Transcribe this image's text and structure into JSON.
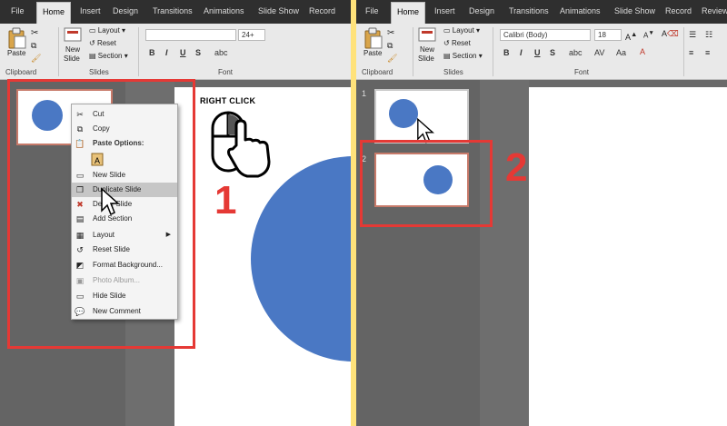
{
  "ribbon_tabs": [
    "File",
    "Home",
    "Insert",
    "Design",
    "Transitions",
    "Animations",
    "Slide Show",
    "Record"
  ],
  "ribbon_tabs_right": [
    "File",
    "Home",
    "Insert",
    "Design",
    "Transitions",
    "Animations",
    "Slide Show",
    "Record",
    "Review"
  ],
  "ribbon": {
    "paste": "Paste",
    "new_slide": "New\nSlide",
    "new_slide_line1": "New",
    "new_slide_line2": "Slide",
    "layout": "Layout",
    "reset": "Reset",
    "section": "Section",
    "clipboard": "Clipboard",
    "slides": "Slides",
    "font": "Font",
    "font_size_left": "24+",
    "font_name_right": "Calibri (Body)",
    "font_size_right": "18"
  },
  "left_panel": {
    "instruction": "RIGHT CLICK",
    "step_number": "1",
    "context_menu": [
      {
        "label": "Cut",
        "icon": "scissors-icon",
        "state": "normal"
      },
      {
        "label": "Copy",
        "icon": "copy-icon",
        "state": "normal"
      },
      {
        "label": "Paste Options:",
        "icon": "paste-options-icon",
        "state": "header"
      },
      {
        "label": "",
        "icon": "paste-keep-text-icon",
        "state": "icon-only"
      },
      {
        "label": "New Slide",
        "icon": "new-slide-icon",
        "state": "normal"
      },
      {
        "label": "Duplicate Slide",
        "icon": "duplicate-slide-icon",
        "state": "highlighted"
      },
      {
        "label": "Delete Slide",
        "icon": "delete-slide-icon",
        "state": "normal"
      },
      {
        "label": "Add Section",
        "icon": "add-section-icon",
        "state": "normal"
      },
      {
        "label": "Layout",
        "icon": "layout-icon",
        "state": "submenu"
      },
      {
        "label": "Reset Slide",
        "icon": "reset-slide-icon",
        "state": "normal"
      },
      {
        "label": "Format Background...",
        "icon": "format-background-icon",
        "state": "normal"
      },
      {
        "label": "Photo Album...",
        "icon": "photo-album-icon",
        "state": "disabled"
      },
      {
        "label": "Hide Slide",
        "icon": "hide-slide-icon",
        "state": "normal"
      },
      {
        "label": "New Comment",
        "icon": "new-comment-icon",
        "state": "normal"
      }
    ]
  },
  "right_panel": {
    "step_number": "2",
    "slide_numbers": [
      "1",
      "2"
    ]
  },
  "colors": {
    "highlight": "#e53935",
    "shape_fill": "#4a78c4",
    "divider": "#ffe27a"
  }
}
